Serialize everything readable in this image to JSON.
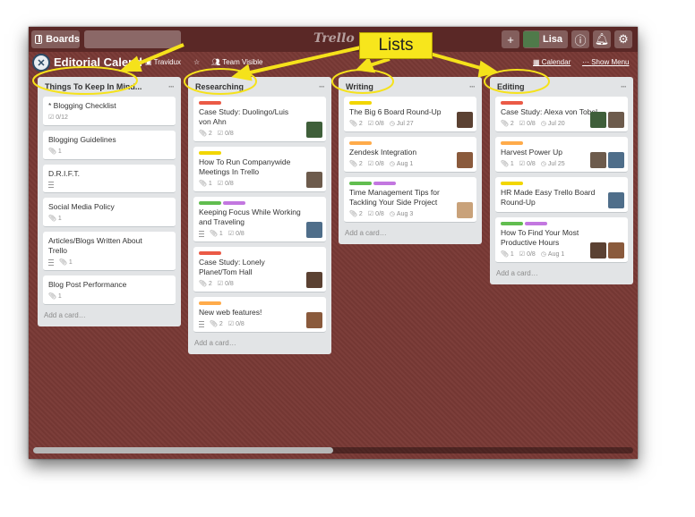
{
  "colors": {
    "board_bg": "#7a3a36",
    "green": "#61bd4f",
    "yellow": "#f2d600",
    "orange": "#ffab4a",
    "red": "#eb5a46",
    "purple": "#c377e0",
    "annotation": "#f7e61c"
  },
  "topbar": {
    "boards_label": "Boards",
    "logo": "Trello",
    "user_name": "Lisa",
    "plus_icon": "plus-icon",
    "info_icon": "info-icon",
    "bell_icon": "bell-icon",
    "gear_icon": "gear-icon"
  },
  "board": {
    "title": "Editorial Calend",
    "org": "Travidux",
    "visibility": "Team Visible",
    "calendar": "Calendar",
    "show_menu": "Show Menu"
  },
  "annotation": {
    "label": "Lists"
  },
  "add_card": "Add a card…",
  "lists": [
    {
      "title": "Things To Keep In Mind...",
      "cards": [
        {
          "title": "* Blogging Checklist",
          "checklist": "0/12"
        },
        {
          "title": "Blogging Guidelines",
          "attachments": "1"
        },
        {
          "title": "D.R.I.F.T."
        },
        {
          "title": "Social Media Policy",
          "attachments": "1"
        },
        {
          "title": "Articles/Blogs Written About Trello",
          "attachments": "1"
        },
        {
          "title": "Blog Post Performance",
          "attachments": "1"
        }
      ]
    },
    {
      "title": "Researching",
      "cards": [
        {
          "title": "Case Study: Duolingo/Luis von Ahn",
          "labels": [
            "red"
          ],
          "attachments": "2",
          "checklist": "0/8"
        },
        {
          "title": "How To Run Companywide Meetings In Trello",
          "labels": [
            "yellow"
          ],
          "attachments": "1",
          "checklist": "0/8"
        },
        {
          "title": "Keeping Focus While Working and Traveling",
          "labels": [
            "green",
            "purple"
          ],
          "attachments": "1",
          "checklist": "0/8"
        },
        {
          "title": "Case Study: Lonely Planet/Tom Hall",
          "labels": [
            "red"
          ],
          "attachments": "2",
          "checklist": "0/8"
        },
        {
          "title": "New web features!",
          "labels": [
            "orange"
          ],
          "attachments": "2",
          "checklist": "0/8"
        }
      ]
    },
    {
      "title": "Writing",
      "cards": [
        {
          "title": "The Big 6 Board Round-Up",
          "labels": [
            "yellow"
          ],
          "attachments": "2",
          "checklist": "0/8",
          "due": "Jul 27"
        },
        {
          "title": "Zendesk Integration",
          "labels": [
            "orange"
          ],
          "attachments": "2",
          "checklist": "0/8",
          "due": "Aug 1"
        },
        {
          "title": "Time Management Tips for Tackling Your Side Project",
          "labels": [
            "green",
            "purple"
          ],
          "attachments": "2",
          "checklist": "0/8",
          "due": "Aug 3"
        }
      ]
    },
    {
      "title": "Editing",
      "cards": [
        {
          "title": "Case Study: Alexa von Tobel",
          "labels": [
            "red"
          ],
          "attachments": "2",
          "checklist": "0/8",
          "due": "Jul 20"
        },
        {
          "title": "Harvest Power Up",
          "labels": [
            "orange"
          ],
          "attachments": "1",
          "checklist": "0/8",
          "due": "Jul 25"
        },
        {
          "title": "HR Made Easy Trello Board Round-Up",
          "labels": [
            "yellow"
          ]
        },
        {
          "title": "How To Find Your Most Productive Hours",
          "labels": [
            "green",
            "purple"
          ],
          "attachments": "1",
          "checklist": "0/8",
          "due": "Aug 1"
        }
      ]
    }
  ]
}
